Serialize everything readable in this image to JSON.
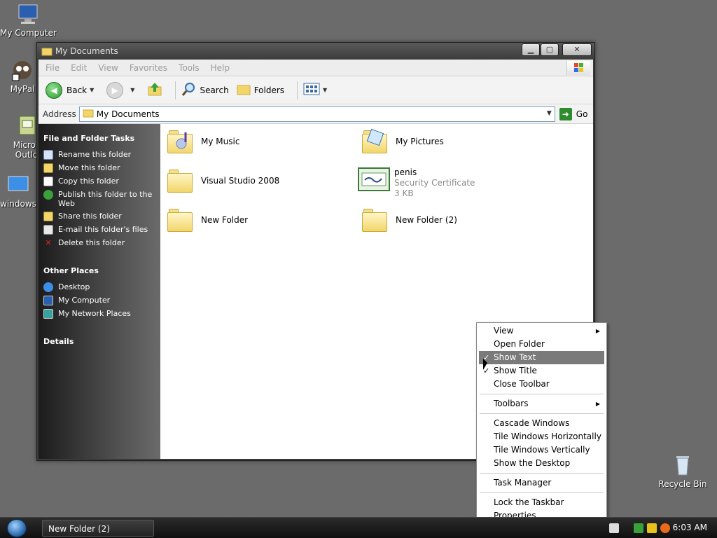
{
  "desktop": {
    "icons": [
      {
        "label": "My Computer"
      },
      {
        "label": "MyPal"
      },
      {
        "label": "Micros Outlo"
      },
      {
        "label": "windows"
      },
      {
        "label": "Recycle Bin"
      }
    ]
  },
  "window": {
    "title": "My Documents",
    "menu": [
      "File",
      "Edit",
      "View",
      "Favorites",
      "Tools",
      "Help"
    ],
    "toolbar": {
      "back": "Back",
      "search": "Search",
      "folders": "Folders"
    },
    "address": {
      "label": "Address",
      "value": "My Documents",
      "go": "Go"
    }
  },
  "sidebar": {
    "file_tasks": {
      "header": "File and Folder Tasks",
      "items": [
        "Rename this folder",
        "Move this folder",
        "Copy this folder",
        "Publish this folder to the Web",
        "Share this folder",
        "E-mail this folder's files",
        "Delete this folder"
      ]
    },
    "other_places": {
      "header": "Other Places",
      "items": [
        "Desktop",
        "My Computer",
        "My Network Places"
      ]
    },
    "details": {
      "header": "Details"
    }
  },
  "files": [
    {
      "name": "My Music"
    },
    {
      "name": "My Pictures"
    },
    {
      "name": "Visual Studio 2008"
    },
    {
      "name": "penis",
      "type": "Security Certificate",
      "size": "3 KB"
    },
    {
      "name": "New Folder"
    },
    {
      "name": "New Folder (2)"
    }
  ],
  "context_menu": {
    "items": [
      {
        "label": "View",
        "has_submenu": true
      },
      {
        "label": "Open Folder"
      },
      {
        "label": "Show Text",
        "checked": true,
        "highlighted": true
      },
      {
        "label": "Show Title",
        "checked": true
      },
      {
        "label": "Close Toolbar"
      },
      {
        "label": "Toolbars",
        "has_submenu": true
      },
      {
        "label": "Cascade Windows"
      },
      {
        "label": "Tile Windows Horizontally"
      },
      {
        "label": "Tile Windows Vertically"
      },
      {
        "label": "Show the Desktop"
      },
      {
        "label": "Task Manager"
      },
      {
        "label": "Lock the Taskbar"
      },
      {
        "label": "Properties"
      }
    ],
    "check_glyph": "✓",
    "submenu_glyph": "▶"
  },
  "taskbar": {
    "task": "New Folder (2)",
    "clock": "6:03 AM"
  }
}
